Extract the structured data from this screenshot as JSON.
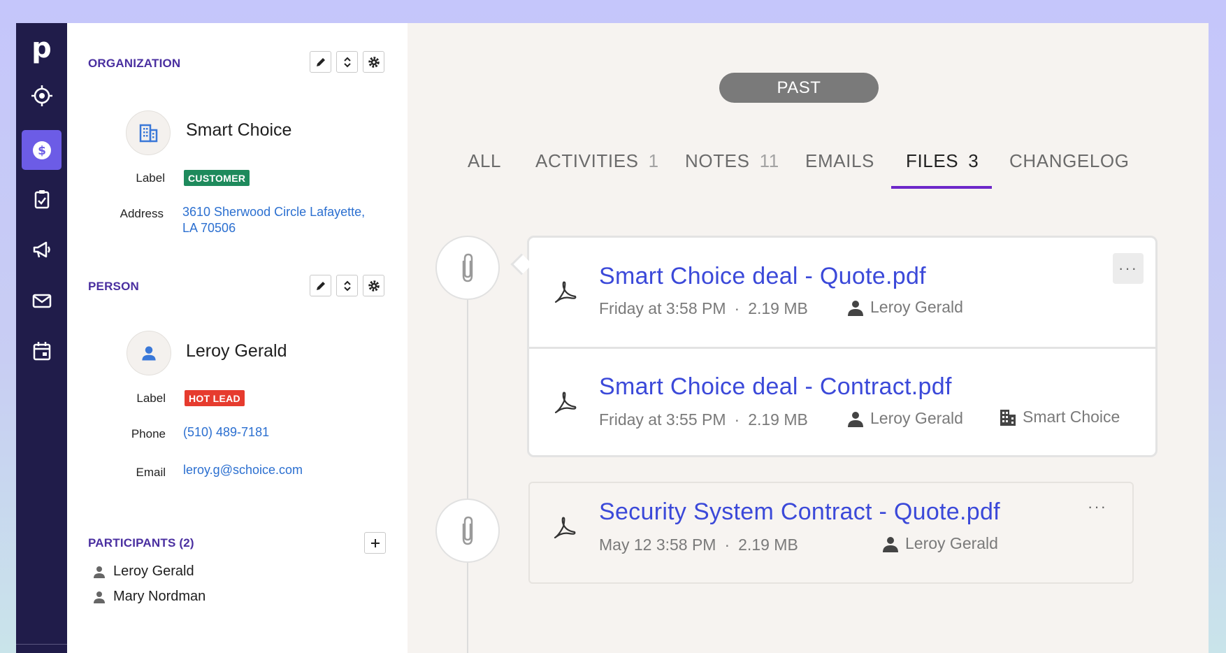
{
  "nav": {
    "logo": "p",
    "items": [
      {
        "name": "target-icon"
      },
      {
        "name": "deals-dollar-icon",
        "active": true
      },
      {
        "name": "activities-checklist-icon"
      },
      {
        "name": "campaigns-megaphone-icon"
      },
      {
        "name": "mail-icon"
      },
      {
        "name": "calendar-icon"
      }
    ],
    "active_color": "#6c5ce6",
    "bg_color": "#201c4a"
  },
  "organization": {
    "title": "ORGANIZATION",
    "name": "Smart Choice",
    "label_caption": "Label",
    "label_value": "CUSTOMER",
    "label_color": "#1e8a5c",
    "address_caption": "Address",
    "address_line1": "3610 Sherwood Circle Lafayette,",
    "address_line2": "LA 70506"
  },
  "person": {
    "title": "PERSON",
    "name": "Leroy Gerald",
    "label_caption": "Label",
    "label_value": "HOT LEAD",
    "label_color": "#e63b2e",
    "phone_caption": "Phone",
    "phone": "(510) 489-7181",
    "email_caption": "Email",
    "email": "leroy.g@schoice.com"
  },
  "participants": {
    "title": "PARTICIPANTS (2)",
    "items": [
      "Leroy Gerald",
      "Mary Nordman"
    ]
  },
  "timeline": {
    "past_label": "PAST",
    "tabs": [
      {
        "label": "ALL",
        "count": ""
      },
      {
        "label": "ACTIVITIES",
        "count": "1"
      },
      {
        "label": "NOTES",
        "count": "11"
      },
      {
        "label": "EMAILS",
        "count": ""
      },
      {
        "label": "FILES",
        "count": "3",
        "active": true
      },
      {
        "label": "CHANGELOG",
        "count": ""
      }
    ],
    "files": [
      {
        "name": "Smart Choice deal - Quote.pdf",
        "time": "Friday at 3:58 PM",
        "size": "2.19 MB",
        "owner": "Leroy Gerald",
        "org": ""
      },
      {
        "name": "Smart Choice deal - Contract.pdf",
        "time": "Friday at 3:55 PM",
        "size": "2.19 MB",
        "owner": "Leroy Gerald",
        "org": "Smart Choice"
      },
      {
        "name": "Security System Contract - Quote.pdf",
        "time": "May 12 3:58 PM",
        "size": "2.19 MB",
        "owner": "Leroy Gerald",
        "org": ""
      }
    ],
    "meta_separator": "·",
    "more_label": "···",
    "link_color": "#3b49d9",
    "active_tab_color": "#6d27c9"
  }
}
